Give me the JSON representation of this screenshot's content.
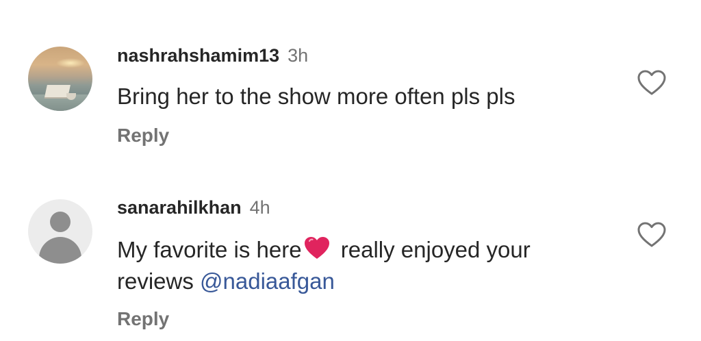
{
  "comments": [
    {
      "username": "nashrahshamim13",
      "time": "3h",
      "text": "Bring her to the show more often pls pls",
      "reply_label": "Reply",
      "avatar": "profile-photo"
    },
    {
      "username": "sanarahilkhan",
      "time": "4h",
      "text_before": "My favorite is here",
      "emoji": "red-heart-emoji",
      "text_after": " really enjoyed your",
      "text_line2": "reviews ",
      "mention": "@nadiaafgan",
      "reply_label": "Reply",
      "avatar": "default-avatar"
    }
  ],
  "colors": {
    "text": "#262626",
    "muted": "#737373",
    "mention": "#385898",
    "heart_emoji": "#e0245e"
  },
  "icons": {
    "like": "heart-outline-icon"
  }
}
